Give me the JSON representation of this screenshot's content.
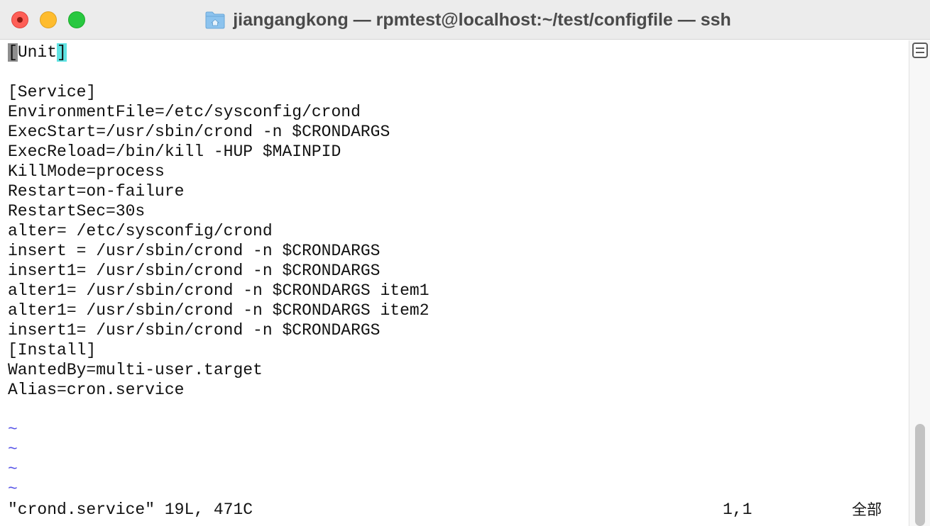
{
  "window": {
    "title": "jiangangkong — rpmtest@localhost:~/test/configfile — ssh",
    "folder_icon": "home-folder-icon"
  },
  "editor": {
    "cursor_char": "[",
    "first_line_middle": "Unit",
    "first_line_match": "]",
    "lines": [
      "",
      "[Service]",
      "EnvironmentFile=/etc/sysconfig/crond",
      "ExecStart=/usr/sbin/crond -n $CRONDARGS",
      "ExecReload=/bin/kill -HUP $MAINPID",
      "KillMode=process",
      "Restart=on-failure",
      "RestartSec=30s",
      "alter= /etc/sysconfig/crond",
      "insert = /usr/sbin/crond -n $CRONDARGS",
      "insert1= /usr/sbin/crond -n $CRONDARGS",
      "alter1= /usr/sbin/crond -n $CRONDARGS item1",
      "alter1= /usr/sbin/crond -n $CRONDARGS item2",
      "insert1= /usr/sbin/crond -n $CRONDARGS",
      "[Install]",
      "WantedBy=multi-user.target",
      "Alias=cron.service",
      ""
    ],
    "tilde": "~",
    "colors": {
      "cursor": "#8e8e8e",
      "bracket_match": "#5fe3e3",
      "tilde": "#5552e6"
    }
  },
  "status": {
    "file_info": "\"crond.service\" 19L, 471C",
    "position": "1,1",
    "scroll_indicator": "全部"
  }
}
